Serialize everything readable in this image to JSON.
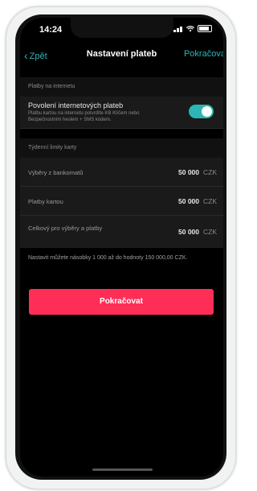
{
  "status_bar": {
    "time": "14:24"
  },
  "nav": {
    "back_label": "Zpět",
    "back_chevron": "‹",
    "title": "Nastavení plateb",
    "right_label": "Pokračovat"
  },
  "sections": {
    "internet_header": "Platby na internetu",
    "limits_header": "Týdenní limity karty"
  },
  "internet_toggle": {
    "title": "Povolení internetových plateb",
    "subtitle": "Platbu kartou na internetu potvrdíte KB Klíčem nebo Bezpečnostním heslem + SMS kódem.",
    "enabled": true
  },
  "limits": [
    {
      "label": "Výběry z bankomatů",
      "value": "50 000",
      "currency": "CZK"
    },
    {
      "label": "Platby kartou",
      "value": "50 000",
      "currency": "CZK"
    },
    {
      "label": "Celkový pro výběry a platby",
      "value": "50 000",
      "currency": "CZK"
    }
  ],
  "note": "Nastavit můžete násobky 1 000 až do hodnoty 150 000,00 CZK.",
  "cta_label": "Pokračovat",
  "colors": {
    "accent": "#2db5b6",
    "cta": "#ff2e57",
    "background": "#000000"
  }
}
